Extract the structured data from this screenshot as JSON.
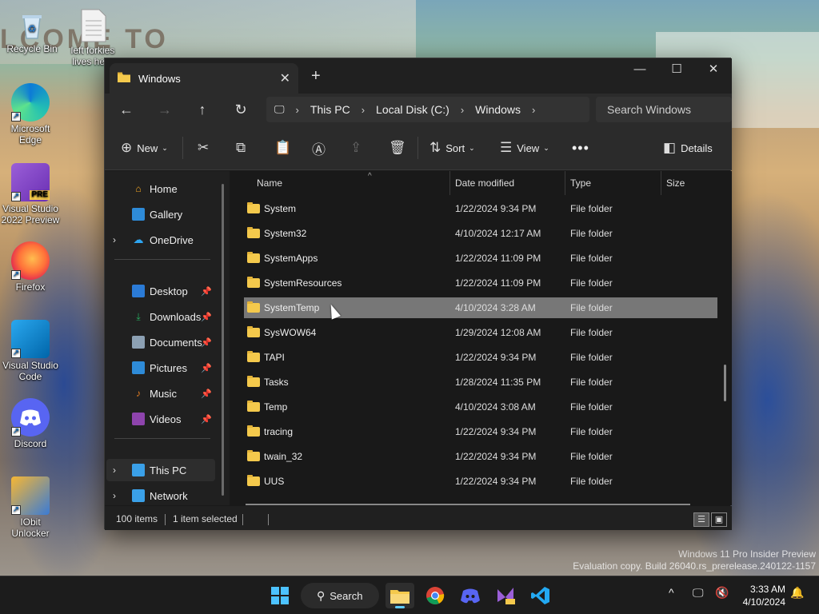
{
  "desktop": {
    "wallpaper_text": "LCOME TO",
    "icons": [
      {
        "label": "Recycle Bin",
        "icon": "recycle-bin-icon"
      },
      {
        "label": "left forkies lives here",
        "icon": "text-file-icon"
      },
      {
        "label": "Microsoft Edge",
        "icon": "edge-icon"
      },
      {
        "label": "Visual Studio 2022 Preview",
        "icon": "visual-studio-preview-icon",
        "badge": "PRE"
      },
      {
        "label": "Firefox",
        "icon": "firefox-icon"
      },
      {
        "label": "Visual Studio Code",
        "icon": "vscode-icon"
      },
      {
        "label": "Discord",
        "icon": "discord-icon"
      },
      {
        "label": "IObit Unlocker",
        "icon": "iobit-unlocker-icon"
      }
    ],
    "watermark_line1": "Windows 11 Pro Insider Preview",
    "watermark_line2": "Evaluation copy. Build 26040.rs_prerelease.240122-1157"
  },
  "explorer": {
    "tab_title": "Windows",
    "address": {
      "this_pc": "This PC",
      "local_disk": "Local Disk (C:)",
      "folder": "Windows"
    },
    "search_placeholder": "Search Windows",
    "toolbar": {
      "new": "New",
      "sort": "Sort",
      "view": "View",
      "details": "Details"
    },
    "nav": {
      "home": "Home",
      "gallery": "Gallery",
      "onedrive": "OneDrive",
      "desktop": "Desktop",
      "downloads": "Downloads",
      "documents": "Documents",
      "pictures": "Pictures",
      "music": "Music",
      "videos": "Videos",
      "this_pc": "This PC",
      "network": "Network"
    },
    "columns": {
      "name": "Name",
      "date_modified": "Date modified",
      "type": "Type",
      "size": "Size"
    },
    "rows": [
      {
        "name": "System",
        "date": "1/22/2024 9:34 PM",
        "type": "File folder"
      },
      {
        "name": "System32",
        "date": "4/10/2024 12:17 AM",
        "type": "File folder"
      },
      {
        "name": "SystemApps",
        "date": "1/22/2024 11:09 PM",
        "type": "File folder"
      },
      {
        "name": "SystemResources",
        "date": "1/22/2024 11:09 PM",
        "type": "File folder"
      },
      {
        "name": "SystemTemp",
        "date": "4/10/2024 3:28 AM",
        "type": "File folder",
        "selected": true
      },
      {
        "name": "SysWOW64",
        "date": "1/29/2024 12:08 AM",
        "type": "File folder"
      },
      {
        "name": "TAPI",
        "date": "1/22/2024 9:34 PM",
        "type": "File folder"
      },
      {
        "name": "Tasks",
        "date": "1/28/2024 11:35 PM",
        "type": "File folder"
      },
      {
        "name": "Temp",
        "date": "4/10/2024 3:08 AM",
        "type": "File folder"
      },
      {
        "name": "tracing",
        "date": "1/22/2024 9:34 PM",
        "type": "File folder"
      },
      {
        "name": "twain_32",
        "date": "1/22/2024 9:34 PM",
        "type": "File folder"
      },
      {
        "name": "UUS",
        "date": "1/22/2024 9:34 PM",
        "type": "File folder"
      }
    ],
    "status": {
      "items": "100 items",
      "selected": "1 item selected"
    }
  },
  "taskbar": {
    "search_label": "Search",
    "time": "3:33 AM",
    "date": "4/10/2024"
  },
  "colors": {
    "folder": "#f4c94c",
    "accent": "#60cdff",
    "selected_row": "#777777"
  }
}
